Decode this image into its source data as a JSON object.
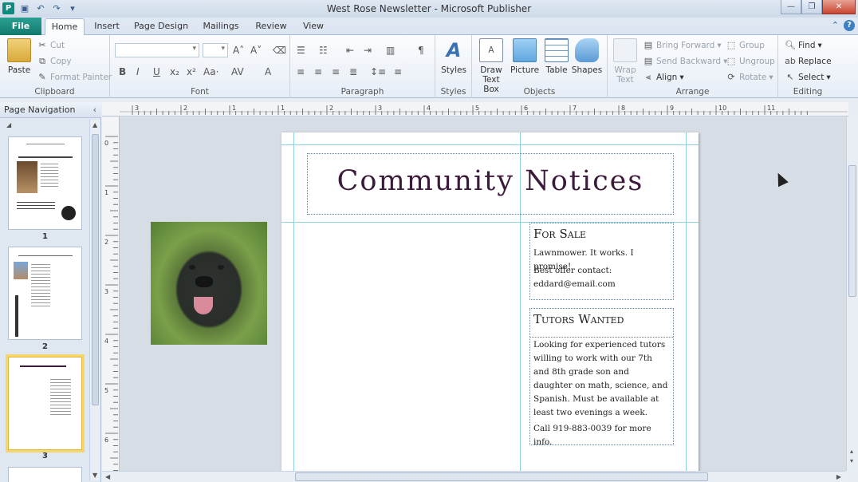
{
  "window": {
    "title": "West Rose Newsletter - Microsoft Publisher",
    "app_icon": "P",
    "controls": [
      "minimize-icon",
      "maximize-icon",
      "close-icon"
    ]
  },
  "quick_access": [
    "save-icon",
    "undo-icon",
    "redo-icon",
    "customize-icon"
  ],
  "tabs": [
    {
      "label": "File"
    },
    {
      "label": "Home"
    },
    {
      "label": "Insert"
    },
    {
      "label": "Page Design"
    },
    {
      "label": "Mailings"
    },
    {
      "label": "Review"
    },
    {
      "label": "View"
    }
  ],
  "ribbon": {
    "clipboard": {
      "label": "Clipboard",
      "paste": "Paste",
      "cut": "Cut",
      "copy": "Copy",
      "format_painter": "Format Painter"
    },
    "font": {
      "label": "Font",
      "buttons": [
        "B",
        "I",
        "U",
        "x₂",
        "x²",
        "Aa·",
        "AV",
        "A"
      ]
    },
    "paragraph": {
      "label": "Paragraph",
      "pilcrow": "¶"
    },
    "styles": {
      "label": "Styles",
      "styles_btn": "Styles"
    },
    "objects": {
      "label": "Objects",
      "draw_text_box": "Draw Text Box",
      "picture": "Picture",
      "table": "Table",
      "shapes": "Shapes"
    },
    "arrange": {
      "label": "Arrange",
      "wrap_text": "Wrap Text",
      "bring_forward": "Bring Forward",
      "send_backward": "Send Backward",
      "align": "Align",
      "group": "Group",
      "ungroup": "Ungroup",
      "rotate": "Rotate"
    },
    "editing": {
      "label": "Editing",
      "find": "Find",
      "replace": "Replace",
      "select": "Select"
    }
  },
  "nav": {
    "title": "Page Navigation",
    "pages": [
      {
        "num": "1"
      },
      {
        "num": "2"
      },
      {
        "num": "3"
      }
    ]
  },
  "document": {
    "title": "Community Notices",
    "for_sale": {
      "heading": "For Sale",
      "line1": "Lawnmower. It works. I promise!",
      "line2": "Best offer contact:",
      "line3": "eddard@email.com"
    },
    "tutors": {
      "heading": "Tutors Wanted",
      "body": "Looking for experienced tutors willing to work with our 7th and 8th grade son and daughter on math, science, and Spanish. Must be available at least two evenings a week.",
      "contact": "Call 919-883-0039 for more info."
    }
  },
  "ruler": {
    "h_labels": [
      "3",
      "2",
      "1",
      "1",
      "2",
      "3",
      "4",
      "5",
      "6",
      "7",
      "8",
      "9",
      "10",
      "11"
    ],
    "v_labels": [
      "0",
      "1",
      "2",
      "3",
      "4",
      "5",
      "6"
    ]
  }
}
